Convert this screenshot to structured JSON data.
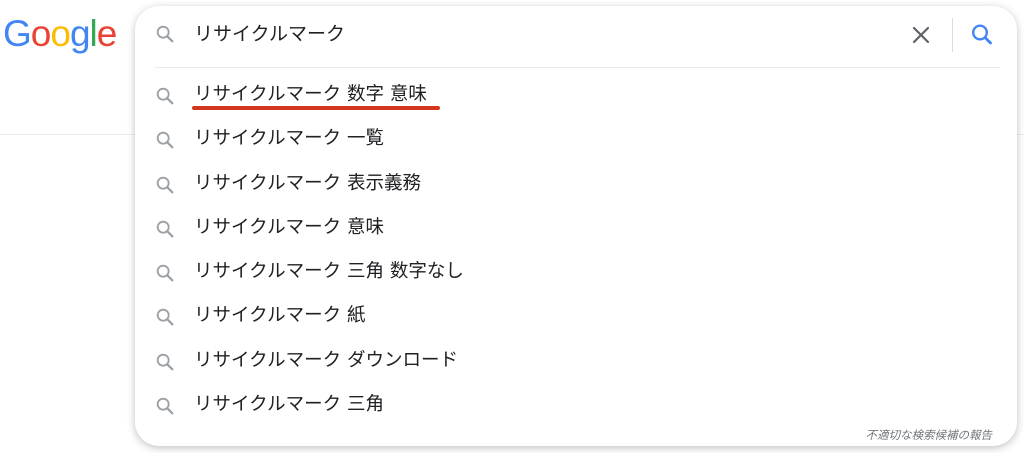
{
  "logo": {
    "letters": [
      {
        "char": "G",
        "color": "#4285F4"
      },
      {
        "char": "o",
        "color": "#EA4335"
      },
      {
        "char": "o",
        "color": "#FBBC05"
      },
      {
        "char": "g",
        "color": "#4285F4"
      },
      {
        "char": "l",
        "color": "#34A853"
      },
      {
        "char": "e",
        "color": "#EA4335"
      }
    ]
  },
  "search": {
    "query": "リサイクルマーク",
    "leading_icon": "search-icon",
    "clear_icon": "close-icon",
    "submit_icon": "search-icon",
    "submit_color": "#4285F4"
  },
  "suggestions": [
    {
      "text": "リサイクルマーク 数字 意味",
      "highlighted": true,
      "highlight_color": "#d3371f"
    },
    {
      "text": "リサイクルマーク 一覧"
    },
    {
      "text": "リサイクルマーク 表示義務"
    },
    {
      "text": "リサイクルマーク 意味"
    },
    {
      "text": "リサイクルマーク 三角 数字なし"
    },
    {
      "text": "リサイクルマーク 紙"
    },
    {
      "text": "リサイクルマーク ダウンロード"
    },
    {
      "text": "リサイクルマーク 三角"
    }
  ],
  "report_link": "不適切な検索候補の報告"
}
